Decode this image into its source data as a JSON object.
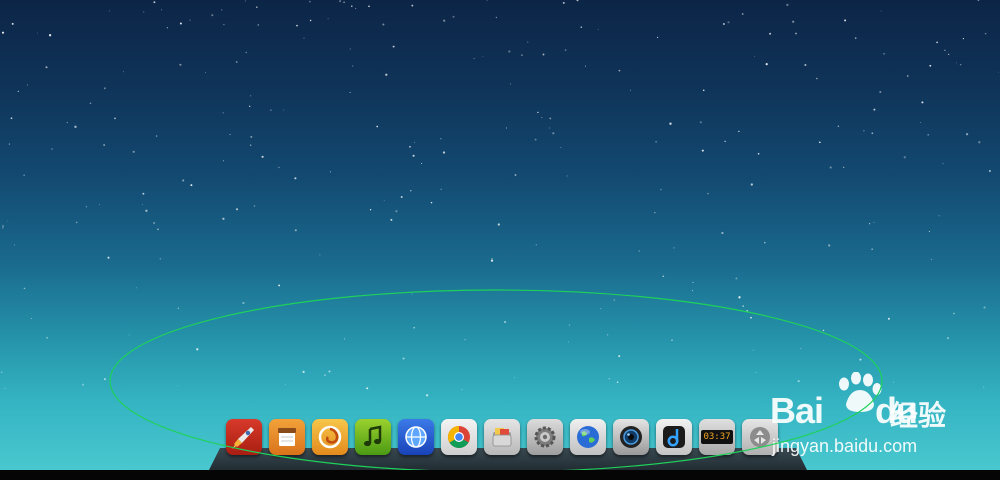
{
  "desktop": {
    "colors": {
      "sky_top": "#0c2547",
      "sky_bottom": "#49c8cf",
      "highlight": "#1fd15a"
    }
  },
  "dock": {
    "items": [
      {
        "name": "rocket-launcher-icon"
      },
      {
        "name": "notes-app-icon"
      },
      {
        "name": "swirl-app-icon"
      },
      {
        "name": "music-note-icon"
      },
      {
        "name": "blue-globe-browser-icon"
      },
      {
        "name": "chrome-browser-icon"
      },
      {
        "name": "file-manager-icon"
      },
      {
        "name": "settings-gear-icon"
      },
      {
        "name": "earth-browser-icon"
      },
      {
        "name": "camera-lens-icon"
      },
      {
        "name": "d-music-player-icon"
      },
      {
        "name": "clock-icon",
        "time": "03:37"
      },
      {
        "name": "recycle-bin-icon"
      }
    ]
  },
  "watermark": {
    "brand_latin": "Bai",
    "brand_latin_2": "du",
    "brand_cn": "经验",
    "url": "jingyan.baidu.com"
  }
}
